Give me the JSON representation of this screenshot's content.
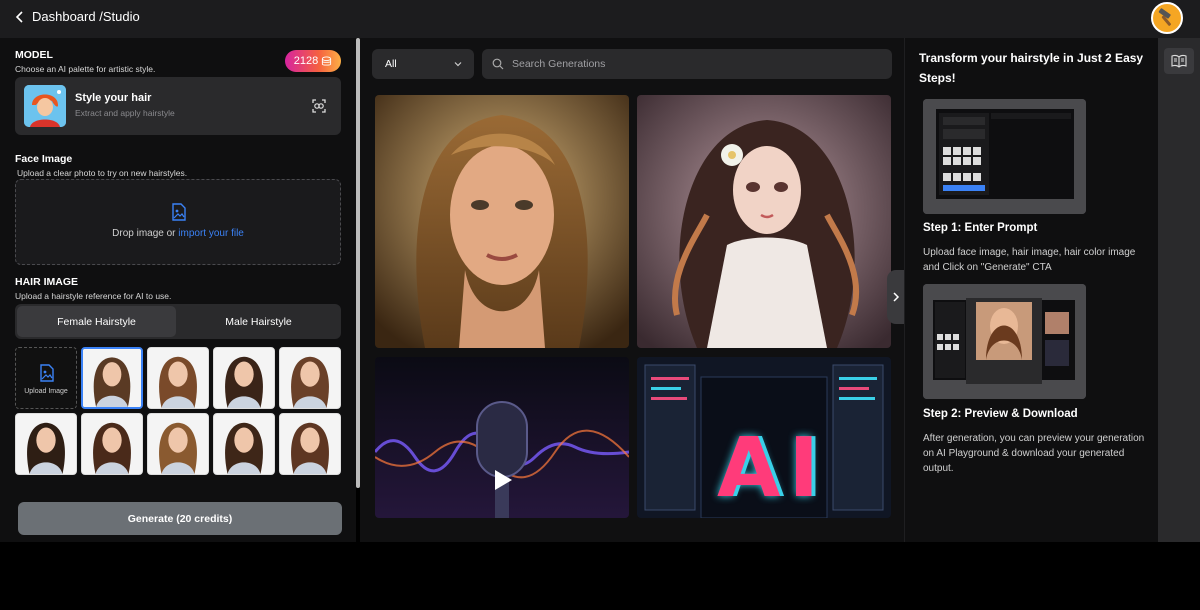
{
  "header": {
    "breadcrumb": "Dashboard /Studio"
  },
  "model": {
    "title": "MODEL",
    "subtitle": "Choose an AI palette for artistic style.",
    "credits": "2128",
    "card_name": "Style your hair",
    "card_desc": "Extract and apply hairstyle"
  },
  "face": {
    "title": "Face Image",
    "subtitle": "Upload a clear photo to try on new hairstyles.",
    "drop_text": "Drop image or ",
    "drop_link": "import your file"
  },
  "hair": {
    "title": "HAIR IMAGE",
    "subtitle": "Upload a hairstyle reference for AI to use.",
    "tabs": [
      "Female Hairstyle",
      "Male Hairstyle"
    ],
    "upload_label": "Upload Image"
  },
  "generate_label": "Generate (20 credits)",
  "gallery": {
    "filter": "All",
    "search_placeholder": "Search Generations",
    "ai_text": "AI"
  },
  "guide": {
    "title": "Transform your hairstyle in Just 2 Easy Steps!",
    "step1_title": "Step 1: Enter Prompt",
    "step1_desc": "Upload face image, hair image, hair color image and Click on \"Generate\" CTA",
    "step2_title": "Step 2: Preview & Download",
    "step2_desc": "After generation, you can preview your generation on AI Playground & download your generated output."
  },
  "colors": {
    "accent": "#3b82f6",
    "credits_gradient_start": "#d6249f",
    "credits_gradient_end": "#fcaf45"
  }
}
